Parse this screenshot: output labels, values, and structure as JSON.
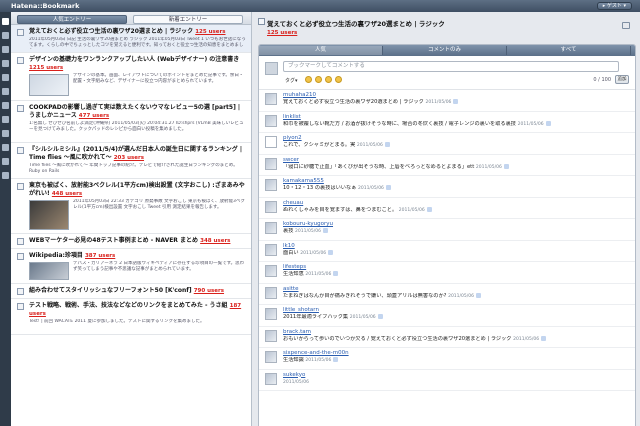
{
  "app": {
    "title": "Hatena::Bookmark",
    "user_label": "▸ ゲスト ▾"
  },
  "tabs": [
    "人気エントリー",
    "新着エントリー"
  ],
  "entries": [
    {
      "title": "覚えておくと必ず役立つ生活の裏ワザ20選まとめ | ラジック",
      "users": "125 users",
      "desc": "2011年05月03日 日記 生活の裏ワザ20選まとめ ラジック 2011年05月03日 Tweet 1 いつもお世話になってます。くらしの中でちょっとしたコツを覚えると便利です。知っておくと役立つ生活の知恵をまとめました。"
    },
    {
      "title": "デザインの基礎力をワンランクアップしたい人 (Webデザイナー) の注意書き",
      "users": "1215 users",
      "desc": "デザインの基本。画面、レイアウトについてのポイントをまとめた記事です。余白・配置・文字組みなど、デザイナーに役立つ内容がまとめられています。"
    },
    {
      "title": "COOKPADの影響し過ぎて実は数えたくないウマなレビュー5の選 [part5] | うましかニュース",
      "users": "477 users",
      "desc": "1:名無し ぜひぜひ名前しよ満足(沖縄県) 2011/05/03(火) 20:04:31.27 ID:shprs (VLmB 美味しいレビューを見つけてみました。クックパッドのレシピから面白い投稿を集めました。"
    },
    {
      "title": "『シルシルミシル』(2011/5/4)が選んだ日本人の誕生日に関するランキング | Time flies 〜風に吹かれて〜",
      "users": "203 users",
      "desc": "Time flies 〜風に吹かれて〜 年間トップ記事の紹介。テレビで紹介された誕生日ランキングのまとめ。Ruby on Rails"
    },
    {
      "title": "東京も被ばく、放射能3ベクレル(1平方cm)検出設置 (文字おこし) :ざまあみやがれい!",
      "users": "448 users",
      "desc": "2011年05月03日 22:33 カテゴリ 原発事故 文字おこし 東京も被ばく、放射能3ベクレル(1平方cm)検出設置 文字おこし Tweet 引用 測定結果を報告します。"
    },
    {
      "title": "WEBマーケター必見の48テスト事例まとめ - NAVER まとめ",
      "users": "348 users",
      "desc": ""
    },
    {
      "title": "Wikipedia:珍項目",
      "users": "387 users",
      "desc": "デパス・カリアーネラ 2 日本語版ウィキペディアに存在する珍項目の一覧です。思わず笑ってしまう記事や不思議な記事がまとめられています。"
    },
    {
      "title": "組み合わせてスタイリッシュなフリーフォント50 [K'conf]",
      "users": "790 users",
      "desc": ""
    },
    {
      "title": "テスト戦略、戦術、手法、技法などなどのリンクをまとめてみた - うさ組",
      "users": "187 users",
      "desc": "Test! | 前回 WACATE 2011 夏に参加しました。テストに関するリンクを集めました。"
    }
  ],
  "detail": {
    "title": "覚えておくと必ず役立つ生活の裏ワザ20選まとめ | ラジック",
    "users": "125 users",
    "tabs": [
      "人気",
      "コメントのみ",
      "すべて"
    ],
    "comment_placeholder": "ブックマークしてコメントする",
    "tag_label": "タグ▾",
    "count": "0 / 100",
    "add_label": "追加",
    "comments": [
      {
        "user": "muhaha210",
        "text": "覚えておくと必ず役立つ生活の裏ワザ20選まとめ | ラジック",
        "date": "2011/05/06"
      },
      {
        "user": "linklist",
        "text": "和巾を被覆しない靴だ方 / お酒が抜けそうな時に、場合の冬炊く裏技 / 電子レンジの裏いを取る裏技",
        "date": "2011/05/06"
      },
      {
        "user": "piyon2",
        "text": "これで、クシャミがとまる。実",
        "date": "2011/05/06"
      },
      {
        "user": "swcer",
        "text": "「寝口に砂糖で止血」「あくびが出そうな時、上唇をベろっとなめるとよまる」ett",
        "date": "2011/05/06"
      },
      {
        "user": "kamakama555",
        "text": "10・12・13 の裏技はいいなぁ",
        "date": "2011/05/06"
      },
      {
        "user": "cheuau",
        "text": "ぬれくしゃみを目を覚ますは、鼻をつまむこと。",
        "date": "2011/05/06"
      },
      {
        "user": "kobouru-kyugoryu",
        "text": "裏技",
        "date": "2011/05/06"
      },
      {
        "user": "lk10",
        "text": "面白い",
        "date": "2011/05/06"
      },
      {
        "user": "lifesteps",
        "text": "生活知恵",
        "date": "2011/05/06"
      },
      {
        "user": "asitte",
        "text": "たまねぎはなんか目が痛みきれそうで嫌い、頭蓋アリルは無害なのか?",
        "date": "2011/05/06"
      },
      {
        "user": "little_shotarn",
        "text": "2011年最適ライフハック集",
        "date": "2011/05/06"
      },
      {
        "user": "brack.tam",
        "text": "おもいからって歩いのでいつか欠る / 覚えておくと必ず役立つ生活の裏ワザ20選まとめ | ラジック",
        "date": "2011/05/06"
      },
      {
        "user": "sixpence-and-the-m00n",
        "text": "生活知識",
        "date": "2011/05/06"
      },
      {
        "user": "sukekyo",
        "text": "",
        "date": "2011/05/06"
      }
    ]
  },
  "colors": {
    "accent": "#5b6f88",
    "users": "#d9201b",
    "link": "#2a5db0"
  },
  "icons": [
    "bookmark-icon",
    "home-icon",
    "star-icon",
    "settings-icon",
    "share-icon",
    "emoticon-icon"
  ]
}
